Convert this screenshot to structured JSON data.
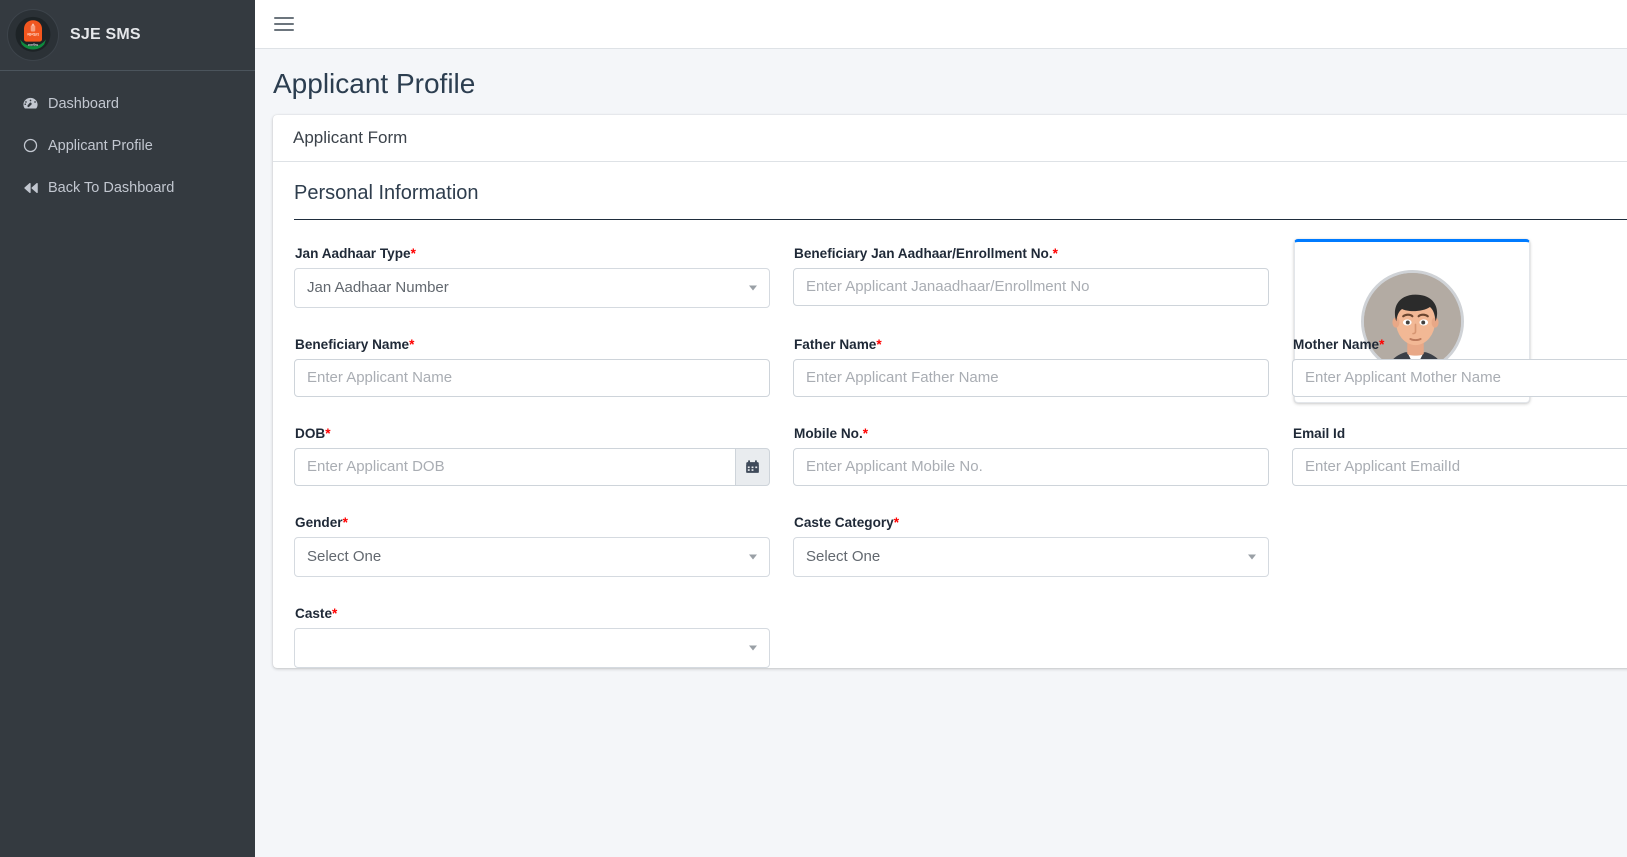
{
  "sidebar": {
    "brand": {
      "title": "SJE SMS",
      "logo_icon": "rajasthan-sje-emblem-icon"
    },
    "items": [
      {
        "label": "Dashboard",
        "icon": "tachometer-icon"
      },
      {
        "label": "Applicant Profile",
        "icon": "circle-icon"
      },
      {
        "label": "Back To Dashboard",
        "icon": "backward-icon"
      }
    ]
  },
  "topbar": {
    "menu_icon": "hamburger-icon"
  },
  "header": {
    "title": "Applicant Profile"
  },
  "card": {
    "header_title": "Applicant Form",
    "section_title": "Personal Information"
  },
  "photo": {
    "icon": "user-avatar-photo",
    "accent_color": "#007bff"
  },
  "fields": {
    "jan_aadhaar_type": {
      "label": "Jan Aadhaar Type",
      "required": true,
      "value": "Jan Aadhaar Number",
      "type": "select"
    },
    "beneficiary_jan_aadhaar_no": {
      "label": "Beneficiary Jan Aadhaar/Enrollment No.",
      "required": true,
      "value": "",
      "placeholder": "Enter Applicant Janaadhaar/Enrollment No",
      "type": "text"
    },
    "beneficiary_name": {
      "label": "Beneficiary Name",
      "required": true,
      "value": "",
      "placeholder": "Enter Applicant Name",
      "type": "text"
    },
    "father_name": {
      "label": "Father Name",
      "required": true,
      "value": "",
      "placeholder": "Enter Applicant Father Name",
      "type": "text"
    },
    "mother_name": {
      "label": "Mother Name",
      "required": true,
      "value": "",
      "placeholder": "Enter Applicant Mother Name",
      "type": "text"
    },
    "dob": {
      "label": "DOB",
      "required": true,
      "value": "",
      "placeholder": "Enter Applicant DOB",
      "type": "text",
      "append_icon": "calendar-icon"
    },
    "mobile_no": {
      "label": "Mobile No.",
      "required": true,
      "value": "",
      "placeholder": "Enter Applicant Mobile No.",
      "type": "text"
    },
    "email_id": {
      "label": "Email Id",
      "required": false,
      "value": "",
      "placeholder": "Enter Applicant EmailId",
      "type": "text"
    },
    "gender": {
      "label": "Gender",
      "required": true,
      "value": "Select One",
      "type": "select"
    },
    "caste_category": {
      "label": "Caste Category",
      "required": true,
      "value": "Select One",
      "type": "select"
    },
    "caste": {
      "label": "Caste",
      "required": true,
      "value": "",
      "type": "select"
    }
  },
  "colors": {
    "sidebar_bg": "#343a40",
    "accent": "#007bff",
    "required_star": "#ff0000",
    "page_bg": "#f4f6f9"
  }
}
